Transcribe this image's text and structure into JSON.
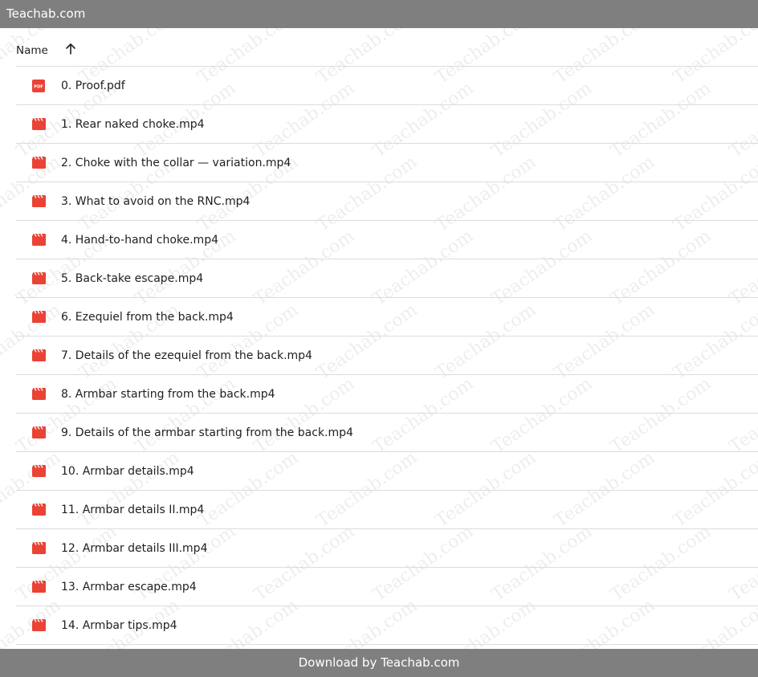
{
  "site_title": "Teachab.com",
  "watermark_text": "Teachab.com",
  "list_header": {
    "name_label": "Name",
    "sort_direction": "ascending",
    "sort_icon": "arrow-up-icon"
  },
  "files": [
    {
      "name": "0. Proof.pdf",
      "type": "pdf",
      "icon": "pdf-icon"
    },
    {
      "name": "1. Rear naked choke.mp4",
      "type": "video",
      "icon": "video-icon"
    },
    {
      "name": "2. Choke with the collar — variation.mp4",
      "type": "video",
      "icon": "video-icon"
    },
    {
      "name": "3. What to avoid on the RNC.mp4",
      "type": "video",
      "icon": "video-icon"
    },
    {
      "name": "4. Hand-to-hand choke.mp4",
      "type": "video",
      "icon": "video-icon"
    },
    {
      "name": "5. Back-take escape.mp4",
      "type": "video",
      "icon": "video-icon"
    },
    {
      "name": "6. Ezequiel from the back.mp4",
      "type": "video",
      "icon": "video-icon"
    },
    {
      "name": "7. Details of the ezequiel from the back.mp4",
      "type": "video",
      "icon": "video-icon"
    },
    {
      "name": "8. Armbar starting from the back.mp4",
      "type": "video",
      "icon": "video-icon"
    },
    {
      "name": "9. Details of the armbar starting from the back.mp4",
      "type": "video",
      "icon": "video-icon"
    },
    {
      "name": "10. Armbar details.mp4",
      "type": "video",
      "icon": "video-icon"
    },
    {
      "name": "11. Armbar details II.mp4",
      "type": "video",
      "icon": "video-icon"
    },
    {
      "name": "12. Armbar details III.mp4",
      "type": "video",
      "icon": "video-icon"
    },
    {
      "name": "13. Armbar escape.mp4",
      "type": "video",
      "icon": "video-icon"
    },
    {
      "name": "14. Armbar tips.mp4",
      "type": "video",
      "icon": "video-icon"
    }
  ],
  "footer": {
    "download_text": "Download by Teachab.com"
  },
  "colors": {
    "bar_background": "#7f7f7f",
    "bar_text": "#ffffff",
    "icon_red": "#ea4335",
    "divider": "#dadce0"
  }
}
